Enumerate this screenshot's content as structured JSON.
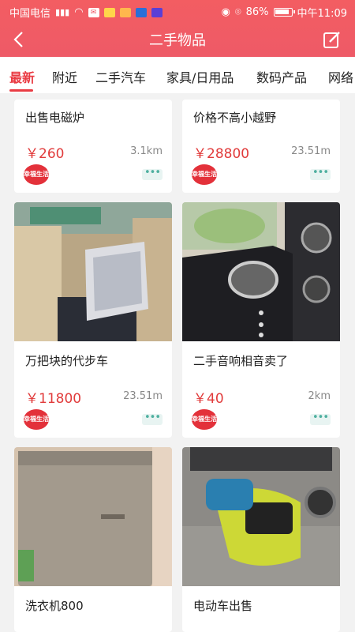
{
  "status": {
    "carrier": "中国电信",
    "battery": "86%",
    "time": "中午11:09"
  },
  "header": {
    "title": "二手物品"
  },
  "tabs": [
    "最新",
    "附近",
    "二手汽车",
    "家具/日用品",
    "数码产品",
    "网络"
  ],
  "cards": [
    {
      "title": "出售电磁炉",
      "price": "￥260",
      "distance": "3.1km"
    },
    {
      "title": "价格不高小越野",
      "price": "￥28800",
      "distance": "23.51m"
    },
    {
      "title": "万把块的代步车",
      "price": "￥11800",
      "distance": "23.51m"
    },
    {
      "title": "二手音响相音卖了",
      "price": "￥40",
      "distance": "2km"
    },
    {
      "title": "洗衣机800"
    },
    {
      "title": "电动车出售"
    }
  ],
  "badge": {
    "text": "幸福生活"
  },
  "colors": {
    "accent": "#e93b43",
    "header": "#f35d62"
  }
}
